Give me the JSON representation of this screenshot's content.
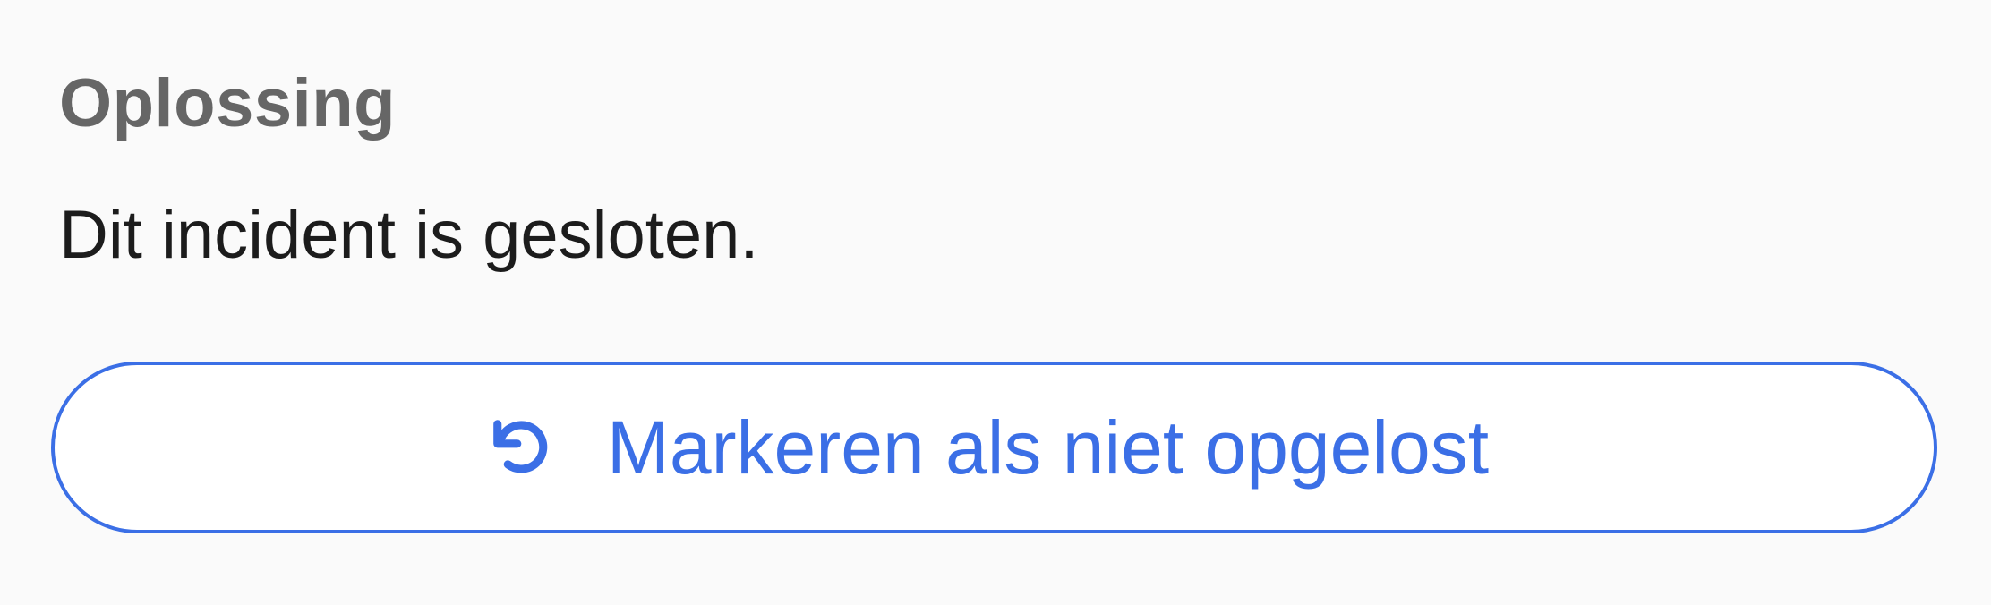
{
  "resolution": {
    "title": "Oplossing",
    "message": "Dit incident is gesloten.",
    "reopen_button": {
      "label": "Markeren als niet opgelost",
      "icon": "undo-icon"
    }
  },
  "colors": {
    "accent": "#3b6fe6",
    "title": "#666666",
    "text": "#1c1c1c",
    "background": "#fafafa"
  }
}
